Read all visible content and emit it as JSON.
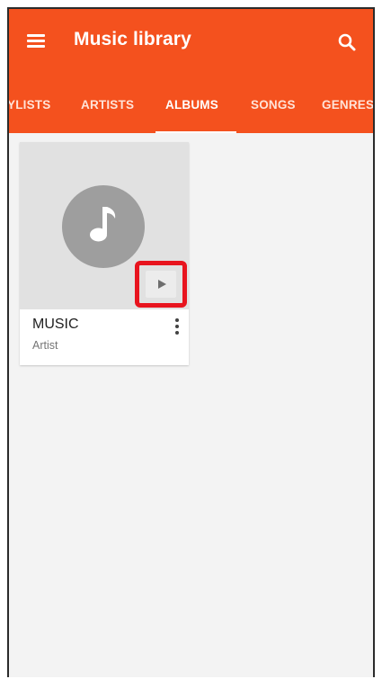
{
  "app": {
    "title": "Music library"
  },
  "tabs": [
    {
      "label": "PLAYLISTS",
      "visible_text": "YLISTS",
      "active": false
    },
    {
      "label": "ARTISTS",
      "active": false
    },
    {
      "label": "ALBUMS",
      "active": true
    },
    {
      "label": "SONGS",
      "active": false
    },
    {
      "label": "GENRES",
      "active": false
    }
  ],
  "albums": [
    {
      "title": "MUSIC",
      "artist": "Artist",
      "art_icon": "music-note-icon"
    }
  ],
  "icons": {
    "menu": "hamburger-menu-icon",
    "search": "search-icon",
    "play": "play-icon",
    "overflow": "more-vert-icon"
  },
  "colors": {
    "app_bar": "#f4511e",
    "highlight": "#e8141e",
    "art_placeholder": "#e1e1e1",
    "note_circle": "#9e9e9e"
  }
}
